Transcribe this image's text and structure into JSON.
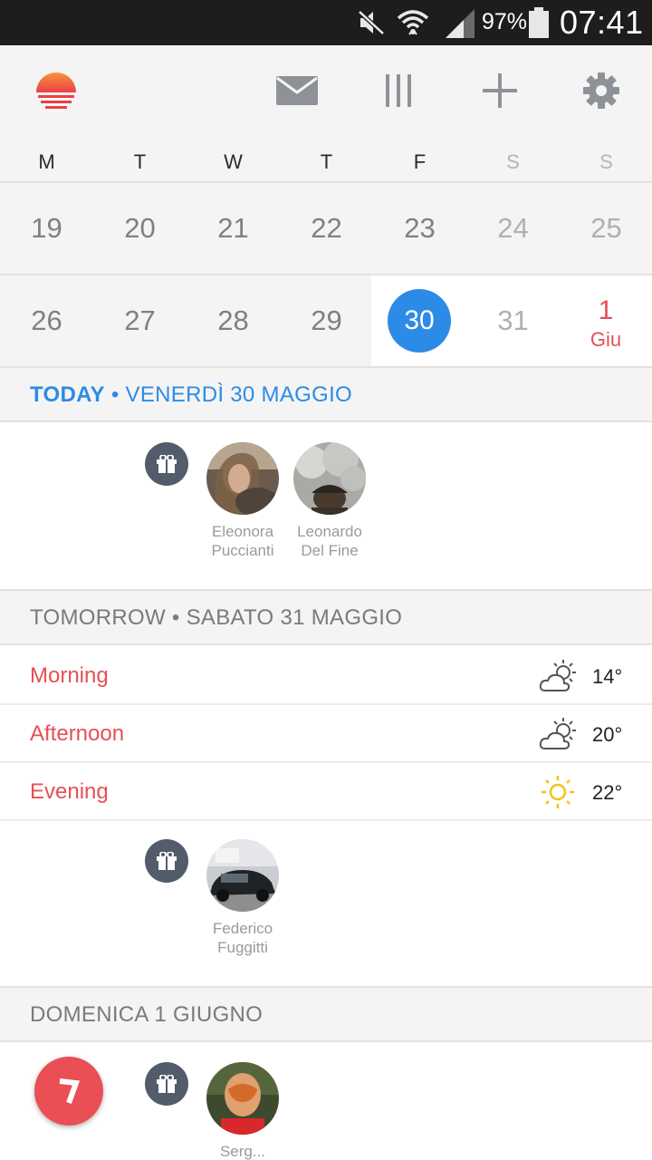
{
  "status_bar": {
    "battery_percent": "97%",
    "time": "07:41",
    "icons": [
      "mute-icon",
      "wifi-icon",
      "signal-icon",
      "battery-icon"
    ]
  },
  "toolbar": {
    "icons": [
      "sunrise-logo-icon",
      "mail-icon",
      "columns-icon",
      "add-icon",
      "settings-icon"
    ]
  },
  "calendar": {
    "weekdays": [
      "M",
      "T",
      "W",
      "T",
      "F",
      "S",
      "S"
    ],
    "week1": [
      "19",
      "20",
      "21",
      "22",
      "23",
      "24",
      "25"
    ],
    "week2": [
      "26",
      "27",
      "28",
      "29",
      "30",
      "31",
      "1"
    ],
    "month_label": "Giu"
  },
  "sections": {
    "today": {
      "strong": "TODAY",
      "rest": " • VENERDÌ 30 MAGGIO"
    },
    "tomorrow": "TOMORROW • SABATO 31 MAGGIO",
    "sunday": "DOMENICA 1 GIUGNO"
  },
  "today_birthdays": [
    {
      "first": "Eleonora",
      "last": "Puccianti"
    },
    {
      "first": "Leonardo",
      "last": "Del Fine"
    }
  ],
  "tomorrow_weather": [
    {
      "label": "Morning",
      "temp": "14°",
      "icon": "partly-cloudy-icon"
    },
    {
      "label": "Afternoon",
      "temp": "20°",
      "icon": "partly-cloudy-icon"
    },
    {
      "label": "Evening",
      "temp": "22°",
      "icon": "sun-icon"
    }
  ],
  "tomorrow_birthdays": [
    {
      "first": "Federico",
      "last": "Fuggitti"
    }
  ],
  "sunday_birthdays": [
    {
      "first": "Serg..."
    }
  ],
  "colors": {
    "accent_blue": "#2c8be6",
    "accent_red": "#e65055",
    "gift_badge": "#525c6b"
  }
}
